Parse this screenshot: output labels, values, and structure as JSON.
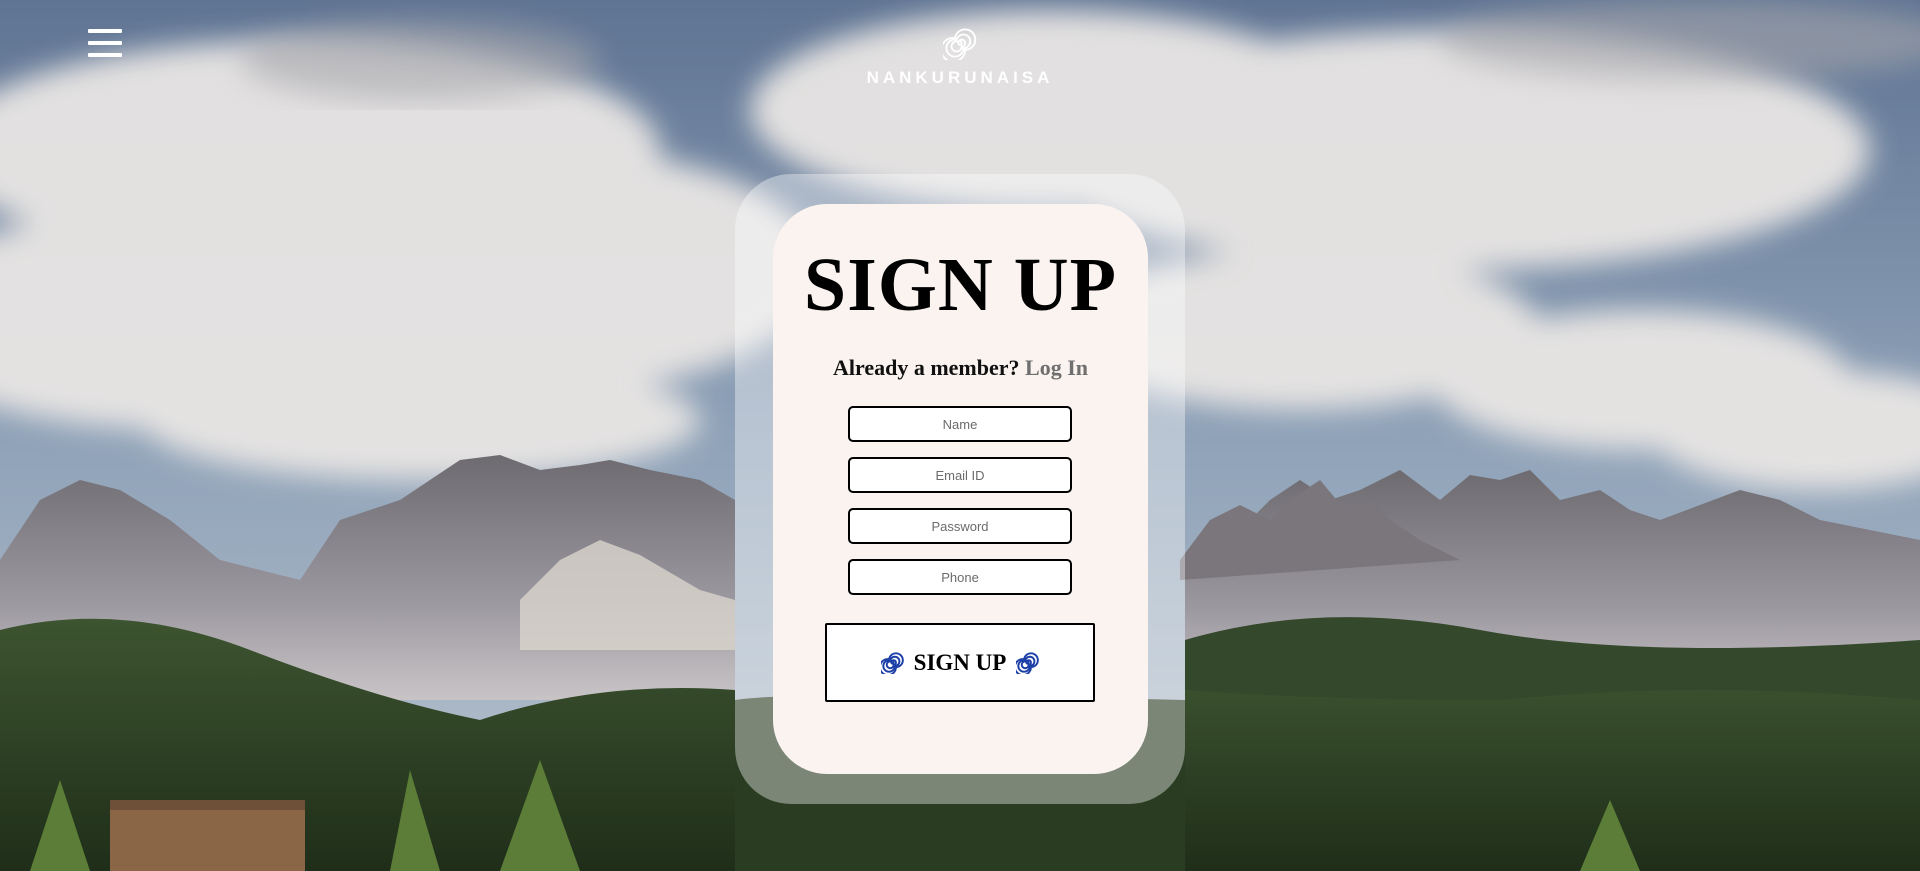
{
  "header": {
    "brand_name": "NANKURUNAISA",
    "menu_icon": "hamburger-menu-icon",
    "logo_icon": "spiral-logo-icon"
  },
  "form": {
    "title": "SIGN UP",
    "member_prompt": "Already a member?",
    "login_link": "Log In",
    "fields": {
      "name_placeholder": "Name",
      "email_placeholder": "Email ID",
      "password_placeholder": "Password",
      "phone_placeholder": "Phone"
    },
    "submit_label": "SIGN UP",
    "submit_icon": "blue-spiral-icon"
  },
  "colors": {
    "accent_spiral": "#1d3fa8",
    "login_link": "#6f6f6f",
    "card_inner": "#faf3f0"
  }
}
